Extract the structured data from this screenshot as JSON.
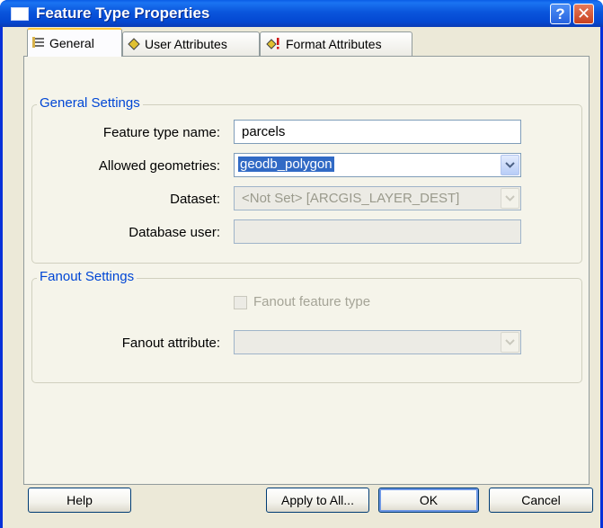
{
  "window": {
    "title": "Feature Type Properties",
    "help_glyph": "?",
    "close_glyph": "✕"
  },
  "tabs": [
    {
      "label": "General",
      "icon": "general-list-icon",
      "active": true
    },
    {
      "label": "User Attributes",
      "icon": "diamond-icon",
      "active": false
    },
    {
      "label": "Format Attributes",
      "icon": "diamond-warning-icon",
      "active": false
    }
  ],
  "general_settings": {
    "title": "General Settings",
    "feature_type_name_label": "Feature type name:",
    "feature_type_name_value": "parcels",
    "allowed_geometries_label": "Allowed geometries:",
    "allowed_geometries_value": "geodb_polygon",
    "dataset_label": "Dataset:",
    "dataset_value": "<Not Set> [ARCGIS_LAYER_DEST]",
    "database_user_label": "Database user:",
    "database_user_value": ""
  },
  "fanout_settings": {
    "title": "Fanout Settings",
    "fanout_feature_type_label": "Fanout feature type",
    "fanout_feature_type_checked": false,
    "fanout_attribute_label": "Fanout attribute:",
    "fanout_attribute_value": ""
  },
  "buttons": {
    "help": "Help",
    "apply_to_all": "Apply to All...",
    "ok": "OK",
    "cancel": "Cancel"
  },
  "colors": {
    "title_bar": "#0a55dc",
    "dialog_bg": "#ece9d8",
    "group_title": "#0046d5",
    "selection": "#316ac5"
  }
}
